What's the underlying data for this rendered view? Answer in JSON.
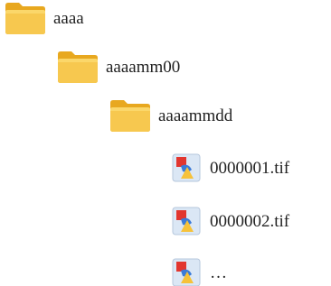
{
  "tree": {
    "folders": [
      {
        "label": "aaaa",
        "icon": "folder-icon"
      },
      {
        "label": "aaaamm00",
        "icon": "folder-icon"
      },
      {
        "label": "aaaammdd",
        "icon": "folder-icon"
      }
    ],
    "files": [
      {
        "label": "0000001.tif",
        "icon": "image-file-icon"
      },
      {
        "label": "0000002.tif",
        "icon": "image-file-icon"
      },
      {
        "label": "…",
        "icon": "image-file-icon"
      }
    ]
  },
  "colors": {
    "folder_back": "#e8a81f",
    "folder_front": "#f7c84f",
    "file_background": "#dbe7f5",
    "shape_red": "#e2362f",
    "shape_blue": "#3b7bd8",
    "shape_yellow": "#f6c23a",
    "label_text": "#222222"
  }
}
